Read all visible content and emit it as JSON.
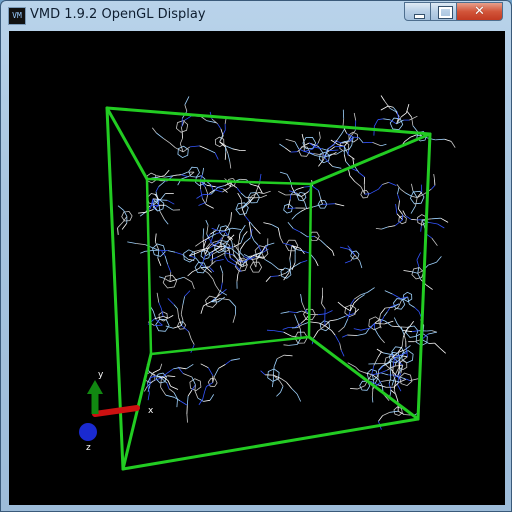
{
  "window": {
    "title": "VMD 1.9.2 OpenGL Display",
    "icon": "vmd-app-icon",
    "controls": {
      "minimize": "minimize-icon",
      "maximize": "maximize-icon",
      "close": "close-icon",
      "close_glyph": "✕"
    }
  },
  "scene": {
    "background": "#000000",
    "box_color": "#22cc22",
    "molecule_colors": [
      "#9fd3ff",
      "#c8c8c8",
      "#3355ff",
      "#ffffff"
    ],
    "axes": {
      "x_label": "x",
      "y_label": "y",
      "z_label": "z",
      "x_color": "#cc1111",
      "y_color": "#118811",
      "z_color": "#1a2ad0"
    }
  }
}
